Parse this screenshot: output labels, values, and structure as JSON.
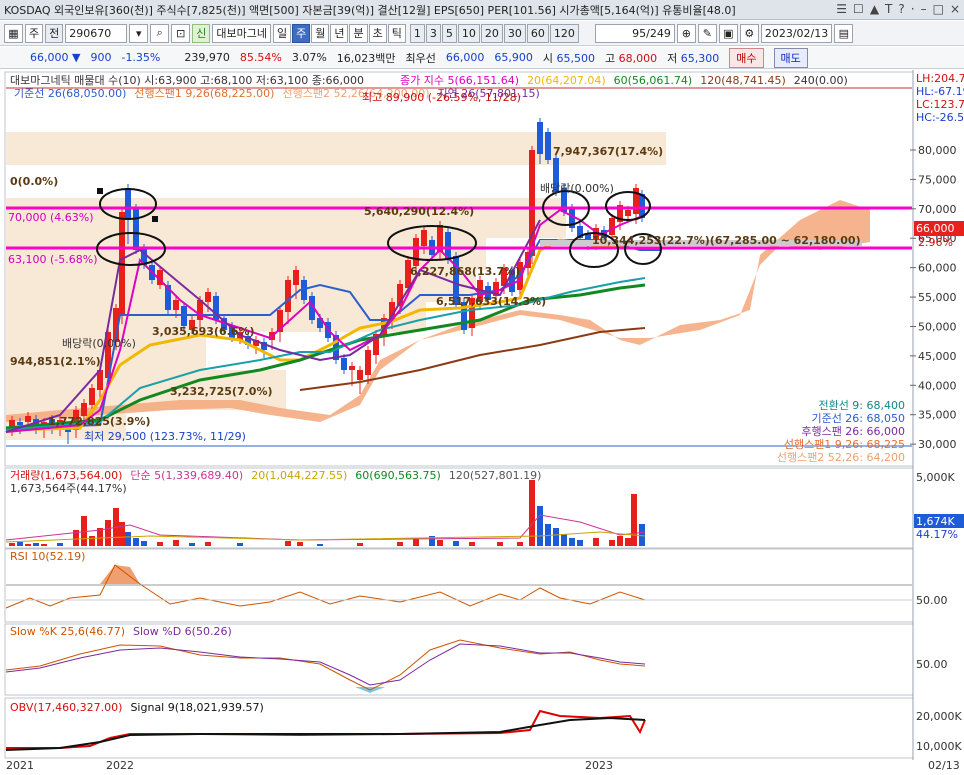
{
  "titlebar": {
    "text": "KOSDAQ 외국인보유[360(천)] 주식수[7,825(천)] 액면[500] 자본금[39(억)] 결산[12월] EPS[650] PER[101.56] 시가총액[5,164(억)] 유통비율[48.0]",
    "icons": [
      "☰",
      "☐",
      "▲",
      "T",
      "?",
      "·",
      "–",
      "□",
      "×"
    ]
  },
  "toolbar": {
    "market": "주",
    "code_label": "전",
    "code": "290670",
    "badge": "신",
    "name": "대보마그네",
    "periods": [
      "일",
      "주",
      "월",
      "년",
      "분",
      "초",
      "틱"
    ],
    "active_period": "주",
    "units": [
      "1",
      "3",
      "5",
      "10",
      "20",
      "30",
      "60",
      "120"
    ],
    "count": "95",
    "count_total": "/249",
    "date": "2023/02/13"
  },
  "quote": {
    "price": "66,000",
    "arrow": "▼",
    "change": "900",
    "pct": "-1.35%",
    "volume": "239,970",
    "vol_ratio": "85.54%",
    "turnover": "3.07%",
    "amount": "16,023백만",
    "best_label": "최우선",
    "best_ask": "66,000",
    "best_bid": "65,900",
    "open_label": "시",
    "open": "65,500",
    "high_label": "고",
    "high": "68,000",
    "low_label": "저",
    "low": "65,300",
    "buy_btn": "매수",
    "sell_btn": "매도"
  },
  "price_panel": {
    "header": "대보마그네틱 매물대 수(10)  시:63,900 고:68,100 저:63,100 종:66,000",
    "ma_labels": [
      "종가 지수 5(66,151.64)",
      "20(64,207.04)",
      "60(56,061.74)",
      "120(48,741.45)",
      "240(0.00)"
    ],
    "ma_colors": [
      "#e000c0",
      "#f2b800",
      "#118820",
      "#8b3a14",
      "#333333"
    ],
    "ichi_labels": [
      "기준선 26(68,050.00)",
      "선행스팬1 9,26(68,225.00)",
      "선행스팬2 52,26(64,200.00)",
      "지연 26(57,801.15)"
    ],
    "annotations": {
      "high": "최고 89,900 (-26.59%, 11/28)",
      "low": "최저 29,500 (123.73%, 11/29)",
      "level0": "0(0.0%)",
      "level70": "70,000 (4.63%)",
      "level63": "63,100 (-5.68%)",
      "div1": "배당락(0.00%)",
      "div2": "배당락(0.00%)",
      "vp1": "7,947,367(17.4%)",
      "vp2": "5,640,290(12.4%)",
      "vp3": "6,227,868(13.7%)",
      "vp4": "6,517,633(14.3%)",
      "vp5": "3,035,693(6.6%)",
      "vp6": "3,232,725(7.0%)",
      "vp7": "944,851(2.1%)",
      "vp8": "1,772,825(3.9%)",
      "vp9": "10,344,253(22.7%)(67,285.00 ~ 62,180.00)"
    },
    "legend_box": [
      {
        "text": "전환선  9: 68,400",
        "color": "#118888"
      },
      {
        "text": "기준선 26: 68,050",
        "color": "#2c5fcc"
      },
      {
        "text": "후행스팬 26: 66,000",
        "color": "#7a2aa0"
      },
      {
        "text": "선행스팬1 9,26: 68,225",
        "color": "#e07030"
      },
      {
        "text": "선행스팬2 52,26: 64,200",
        "color": "#f0a070"
      }
    ],
    "right_tags": [
      {
        "text": "LH:204.75",
        "color": "#d01010"
      },
      {
        "text": "HL:-67.19",
        "color": "#1840c8"
      },
      {
        "text": "LC:123.73",
        "color": "#d01010"
      },
      {
        "text": "HC:-26.59",
        "color": "#1840c8"
      }
    ],
    "y_axis": [
      "80,000",
      "75,000",
      "70,000",
      "65,000",
      "60,000",
      "55,000",
      "50,000",
      "45,000",
      "40,000",
      "35,000",
      "30,000"
    ],
    "current_tag": "66,000",
    "current_pct": "2.96%"
  },
  "volume_panel": {
    "header_labels": [
      "거래량(1,673,564.00)",
      "단순 5(1,339,689.40)",
      "20(1,044,227.55)",
      "60(690,563.75)",
      "120(527,801.19)"
    ],
    "header_colors": [
      "#d01010",
      "#cc3399",
      "#c9a400",
      "#118820",
      "#555555"
    ],
    "sub": "1,673,564주(44.17%)",
    "y_top": "5,000K",
    "tag": "1,674K",
    "tag_pct": "44.17%"
  },
  "rsi_panel": {
    "header": "RSI 10(52.19)",
    "y_label": "50.00"
  },
  "stoch_panel": {
    "header_k": "Slow %K 25,6(46.77)",
    "header_d": "Slow %D 6(50.26)",
    "y_label": "50.00"
  },
  "obv_panel": {
    "header": "OBV(17,460,327.00)",
    "signal": "Signal 9(18,021,939.57)",
    "y_labels": [
      "20,000K",
      "10,000K"
    ]
  },
  "x_axis": {
    "labels": [
      "2021",
      "2022",
      "2023"
    ],
    "right": "02/13"
  },
  "colors": {
    "up": "#e8201c",
    "down": "#1e5bd8",
    "accent": "#ff00cc"
  }
}
